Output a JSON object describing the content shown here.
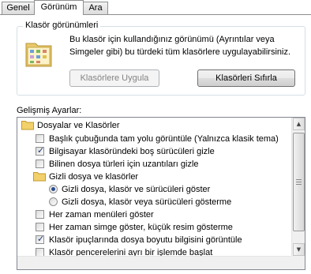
{
  "tabs": [
    {
      "label": "Genel",
      "active": false
    },
    {
      "label": "Görünüm",
      "active": true
    },
    {
      "label": "Ara",
      "active": false
    }
  ],
  "folder_views": {
    "title": "Klasör görünümleri",
    "description": "Bu klasör için kullandığınız görünümü (Ayrıntılar veya Simgeler gibi) bu türdeki tüm klasörlere uygulayabilirsiniz.",
    "apply_button": "Klasörlere Uygula",
    "reset_button": "Klasörleri Sıfırla"
  },
  "advanced": {
    "label": "Gelişmiş Ayarlar:",
    "items": [
      {
        "type": "folder",
        "label": "Dosyalar ve Klasörler",
        "checked": false
      },
      {
        "type": "checkbox",
        "label": "Başlık çubuğunda tam yolu görüntüle (Yalnızca klasik tema)",
        "checked": false
      },
      {
        "type": "checkbox",
        "label": "Bilgisayar klasöründeki boş sürücüleri gizle",
        "checked": true
      },
      {
        "type": "checkbox",
        "label": "Bilinen dosya türleri için uzantıları gizle",
        "checked": false
      },
      {
        "type": "folder",
        "label": "Gizli dosya ve klasörler",
        "checked": false
      },
      {
        "type": "radio",
        "label": "Gizli dosya, klasör ve sürücüleri göster",
        "checked": true
      },
      {
        "type": "radio",
        "label": "Gizli dosya, klasör veya sürücüleri gösterme",
        "checked": false
      },
      {
        "type": "checkbox",
        "label": "Her zaman menüleri göster",
        "checked": false
      },
      {
        "type": "checkbox",
        "label": "Her zaman simge göster, küçük resim gösterme",
        "checked": false
      },
      {
        "type": "checkbox",
        "label": "Klasör ipuçlarında dosya boyutu bilgisini görüntüle",
        "checked": true
      },
      {
        "type": "checkbox",
        "label": "Klasör pencerelerini ayrı bir işlemde başlat",
        "checked": false
      }
    ]
  },
  "colors": {
    "accent": "#2a4d8f",
    "border": "#828790"
  }
}
